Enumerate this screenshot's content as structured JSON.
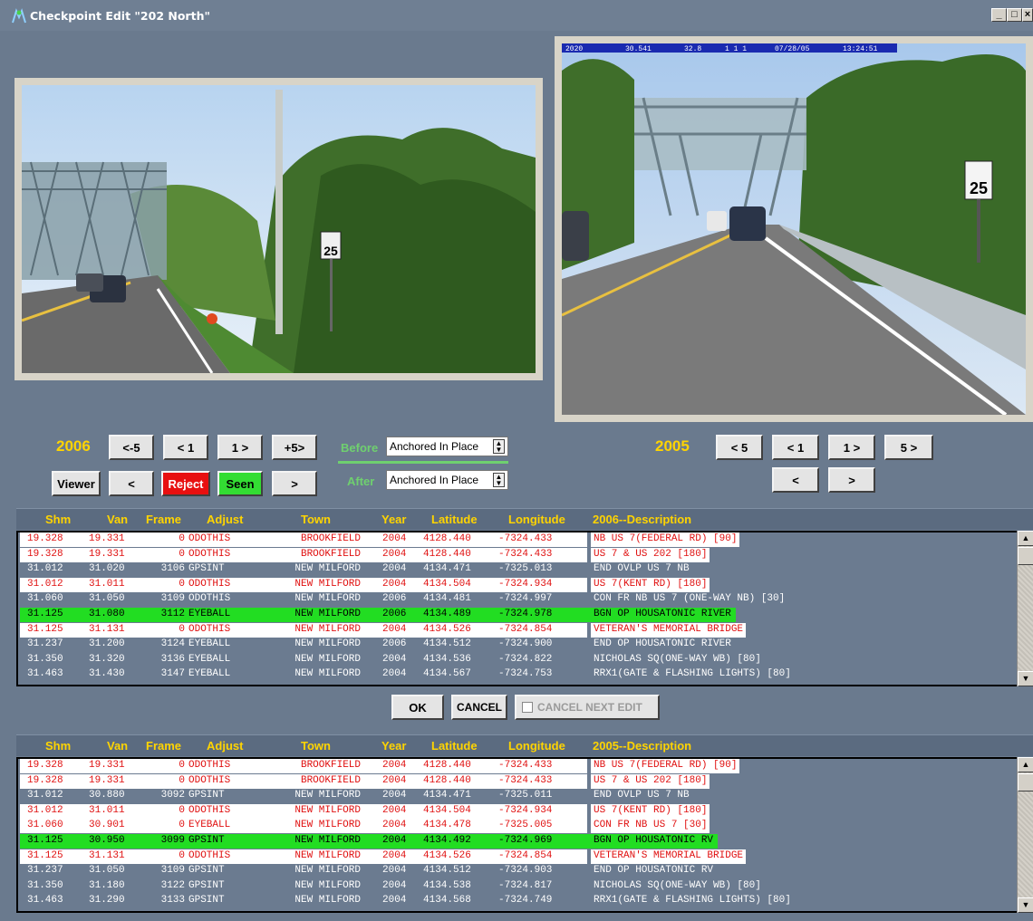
{
  "window": {
    "title": "Checkpoint Edit \"202 North\"",
    "min_label": "_",
    "max_label": "□",
    "close_label": "×"
  },
  "left_panel": {
    "year": "2006",
    "nav_buttons": [
      "<-5",
      "< 1",
      "1 >",
      "+5>"
    ],
    "viewer_label": "Viewer",
    "prev_label": "<",
    "reject_label": "Reject",
    "seen_label": "Seen",
    "next_label": ">"
  },
  "right_panel": {
    "year": "2005",
    "nav_buttons": [
      "< 5",
      "< 1",
      "1 >",
      "5 >"
    ],
    "prev_label": "<",
    "next_label": ">",
    "overlay": [
      "2020",
      "30.541",
      "32.8",
      "1 1 1",
      "07/28/05",
      "13:24:51"
    ]
  },
  "anchor": {
    "before_label": "Before",
    "before_value": "Anchored In Place",
    "after_label": "After",
    "after_value": "Anchored In Place"
  },
  "columns": [
    "Shm",
    "Van",
    "Frame",
    "Adjust",
    "Town",
    "Year",
    "Latitude",
    "Longitude"
  ],
  "desc_header_2006": "2006--Description",
  "desc_header_2005": "2005--Description",
  "table_2006": [
    {
      "shm": "19.328",
      "van": "19.331",
      "frame": "0",
      "adjust": "ODOTHIS",
      "town": "BROOKFIELD",
      "year": "2004",
      "lat": "4128.440",
      "lon": "-7324.433",
      "desc": "NB US 7(FEDERAL RD) [90]",
      "style": "white"
    },
    {
      "shm": "19.328",
      "van": "19.331",
      "frame": "0",
      "adjust": "ODOTHIS",
      "town": "BROOKFIELD",
      "year": "2004",
      "lat": "4128.440",
      "lon": "-7324.433",
      "desc": "US 7 & US 202 [180]",
      "style": "white"
    },
    {
      "shm": "31.012",
      "van": "31.020",
      "frame": "3106",
      "adjust": "GPSINT",
      "town": "NEW MILFORD",
      "year": "2004",
      "lat": "4134.471",
      "lon": "-7325.013",
      "desc": "END OVLP US 7 NB",
      "style": "plain"
    },
    {
      "shm": "31.012",
      "van": "31.011",
      "frame": "0",
      "adjust": "ODOTHIS",
      "town": "NEW MILFORD",
      "year": "2004",
      "lat": "4134.504",
      "lon": "-7324.934",
      "desc": "US 7(KENT RD) [180]",
      "style": "white"
    },
    {
      "shm": "31.060",
      "van": "31.050",
      "frame": "3109",
      "adjust": "ODOTHIS",
      "town": "NEW MILFORD",
      "year": "2006",
      "lat": "4134.481",
      "lon": "-7324.997",
      "desc": "CON FR NB US 7 (ONE-WAY NB) [30]",
      "style": "plain"
    },
    {
      "shm": "31.125",
      "van": "31.080",
      "frame": "3112",
      "adjust": "EYEBALL",
      "town": "NEW MILFORD",
      "year": "2006",
      "lat": "4134.489",
      "lon": "-7324.978",
      "desc": "BGN OP HOUSATONIC RIVER",
      "style": "green"
    },
    {
      "shm": "31.125",
      "van": "31.131",
      "frame": "0",
      "adjust": "ODOTHIS",
      "town": "NEW MILFORD",
      "year": "2004",
      "lat": "4134.526",
      "lon": "-7324.854",
      "desc": "VETERAN'S MEMORIAL BRIDGE",
      "style": "white"
    },
    {
      "shm": "31.237",
      "van": "31.200",
      "frame": "3124",
      "adjust": "EYEBALL",
      "town": "NEW MILFORD",
      "year": "2006",
      "lat": "4134.512",
      "lon": "-7324.900",
      "desc": "END OP HOUSATONIC RIVER",
      "style": "plain"
    },
    {
      "shm": "31.350",
      "van": "31.320",
      "frame": "3136",
      "adjust": "EYEBALL",
      "town": "NEW MILFORD",
      "year": "2004",
      "lat": "4134.536",
      "lon": "-7324.822",
      "desc": "NICHOLAS SQ(ONE-WAY WB) [80]",
      "style": "plain"
    },
    {
      "shm": "31.463",
      "van": "31.430",
      "frame": "3147",
      "adjust": "EYEBALL",
      "town": "NEW MILFORD",
      "year": "2004",
      "lat": "4134.567",
      "lon": "-7324.753",
      "desc": "RRX1(GATE & FLASHING LIGHTS) [80]",
      "style": "plain"
    }
  ],
  "table_2005": [
    {
      "shm": "19.328",
      "van": "19.331",
      "frame": "0",
      "adjust": "ODOTHIS",
      "town": "BROOKFIELD",
      "year": "2004",
      "lat": "4128.440",
      "lon": "-7324.433",
      "desc": "NB US 7(FEDERAL RD) [90]",
      "style": "white"
    },
    {
      "shm": "19.328",
      "van": "19.331",
      "frame": "0",
      "adjust": "ODOTHIS",
      "town": "BROOKFIELD",
      "year": "2004",
      "lat": "4128.440",
      "lon": "-7324.433",
      "desc": "US 7 & US 202 [180]",
      "style": "white"
    },
    {
      "shm": "31.012",
      "van": "30.880",
      "frame": "3092",
      "adjust": "GPSINT",
      "town": "NEW MILFORD",
      "year": "2004",
      "lat": "4134.471",
      "lon": "-7325.011",
      "desc": "END OVLP US 7 NB",
      "style": "plain"
    },
    {
      "shm": "31.012",
      "van": "31.011",
      "frame": "0",
      "adjust": "ODOTHIS",
      "town": "NEW MILFORD",
      "year": "2004",
      "lat": "4134.504",
      "lon": "-7324.934",
      "desc": "US 7(KENT RD) [180]",
      "style": "white"
    },
    {
      "shm": "31.060",
      "van": "30.901",
      "frame": "0",
      "adjust": "EYEBALL",
      "town": "NEW MILFORD",
      "year": "2004",
      "lat": "4134.478",
      "lon": "-7325.005",
      "desc": "CON FR NB US 7 [30]",
      "style": "white"
    },
    {
      "shm": "31.125",
      "van": "30.950",
      "frame": "3099",
      "adjust": "GPSINT",
      "town": "NEW MILFORD",
      "year": "2004",
      "lat": "4134.492",
      "lon": "-7324.969",
      "desc": "BGN OP HOUSATONIC RV",
      "style": "green"
    },
    {
      "shm": "31.125",
      "van": "31.131",
      "frame": "0",
      "adjust": "ODOTHIS",
      "town": "NEW MILFORD",
      "year": "2004",
      "lat": "4134.526",
      "lon": "-7324.854",
      "desc": "VETERAN'S MEMORIAL BRIDGE",
      "style": "white"
    },
    {
      "shm": "31.237",
      "van": "31.050",
      "frame": "3109",
      "adjust": "GPSINT",
      "town": "NEW MILFORD",
      "year": "2004",
      "lat": "4134.512",
      "lon": "-7324.903",
      "desc": "END OP HOUSATONIC RV",
      "style": "plain"
    },
    {
      "shm": "31.350",
      "van": "31.180",
      "frame": "3122",
      "adjust": "GPSINT",
      "town": "NEW MILFORD",
      "year": "2004",
      "lat": "4134.538",
      "lon": "-7324.817",
      "desc": "NICHOLAS SQ(ONE-WAY WB) [80]",
      "style": "plain"
    },
    {
      "shm": "31.463",
      "van": "31.290",
      "frame": "3133",
      "adjust": "GPSINT",
      "town": "NEW MILFORD",
      "year": "2004",
      "lat": "4134.568",
      "lon": "-7324.749",
      "desc": "RRX1(GATE & FLASHING LIGHTS) [80]",
      "style": "plain"
    }
  ],
  "dialog": {
    "ok_label": "OK",
    "cancel_label": "CANCEL",
    "cancel_next_label": "CANCEL NEXT EDIT"
  },
  "colors": {
    "background": "#6a7a8e",
    "year_yellow": "#ffd400",
    "row_red": "#e01010",
    "row_green": "#22dd22",
    "reject_red": "#e81010"
  }
}
